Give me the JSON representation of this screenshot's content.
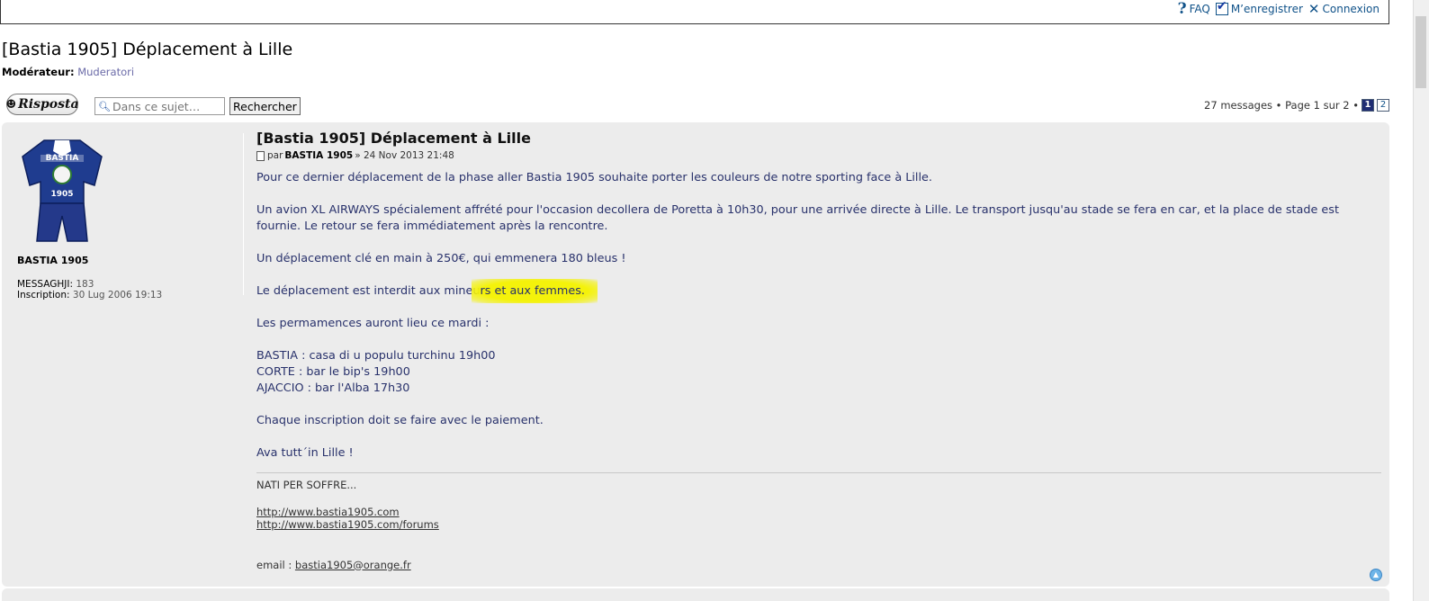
{
  "header": {
    "faq": "FAQ",
    "register": "M’enregistrer",
    "login": "Connexion"
  },
  "topic": {
    "title": "[Bastia 1905] Déplacement à Lille",
    "moderator_label": "Modérateur:",
    "moderator_name": "Muderatori"
  },
  "toolbar": {
    "reply_label": "Risposta",
    "search_placeholder": "Dans ce sujet…",
    "search_button": "Rechercher"
  },
  "pagination": {
    "summary": "27 messages • Page 1 sur 2 •",
    "pages": [
      "1",
      "2"
    ],
    "current": "1"
  },
  "post": {
    "author": "BASTIA 1905",
    "messages_label": "MESSAGHJI:",
    "messages_value": "183",
    "inscription_label": "Inscription:",
    "inscription_value": "30 Lug 2006 19:13",
    "title": "[Bastia 1905] Déplacement à Lille",
    "meta_par": "par",
    "meta_author": "BASTIA 1905",
    "meta_date": "» 24 Nov 2013 21:48",
    "p1": "Pour ce dernier déplacement de la phase aller Bastia 1905 souhaite porter les couleurs de notre sporting face à Lille.",
    "p2": "Un avion XL AIRWAYS spécialement affrété pour l'occasion decollera de Poretta à 10h30, pour une arrivée directe à Lille. Le transport jusqu'au stade se fera en car, et la place de stade est fournie. Le retour se fera immédiatement après la rencontre.",
    "p3": "Un déplacement clé en main à 250€, qui emmenera 180 bleus !",
    "p4_a": "Le déplacement est interdit aux mineu",
    "p4_b": "rs et aux femmes.",
    "p5": "Les permamences auront lieu ce mardi :",
    "line_bastia": "BASTIA : casa di u populu turchinu 19h00",
    "line_corte": "CORTE : bar le bip's 19h00",
    "line_ajaccio": "AJACCIO : bar l'Alba 17h30",
    "p7": "Chaque inscription doit se faire avec le paiement.",
    "p8": "Ava tutt´in Lille !",
    "sig_motto": "NATI PER SOFFRE...",
    "sig_link1": "http://www.bastia1905.com",
    "sig_link2": "http://www.bastia1905.com/forums",
    "sig_email_label": "email :",
    "sig_email": "bastia1905@orange.fr",
    "avatar_text_top": "BASTIA",
    "avatar_text_bottom": "1905"
  },
  "colors": {
    "post_bg": "#ececec",
    "post_text": "#28316b",
    "highlight": "#f4f20b",
    "link": "#105289"
  }
}
